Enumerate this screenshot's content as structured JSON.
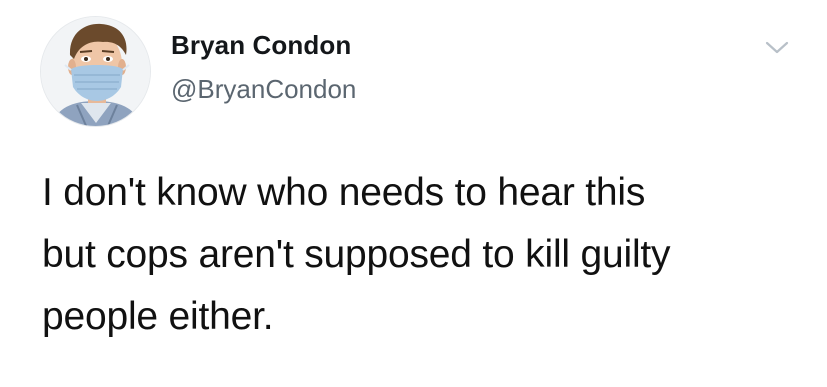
{
  "author": {
    "display_name": "Bryan Condon",
    "handle": "@BryanCondon",
    "avatar_icon": "avatar-photo-masked-man"
  },
  "menu": {
    "icon": "chevron-down-icon"
  },
  "tweet": {
    "lines": [
      "I don't know who needs to hear this",
      "but cops aren't supposed to kill guilty",
      "people either."
    ]
  },
  "colors": {
    "name": "#14171a",
    "handle": "#5b6670",
    "body_text": "#111111",
    "chevron": "#b8c0c8",
    "background": "#ffffff"
  }
}
